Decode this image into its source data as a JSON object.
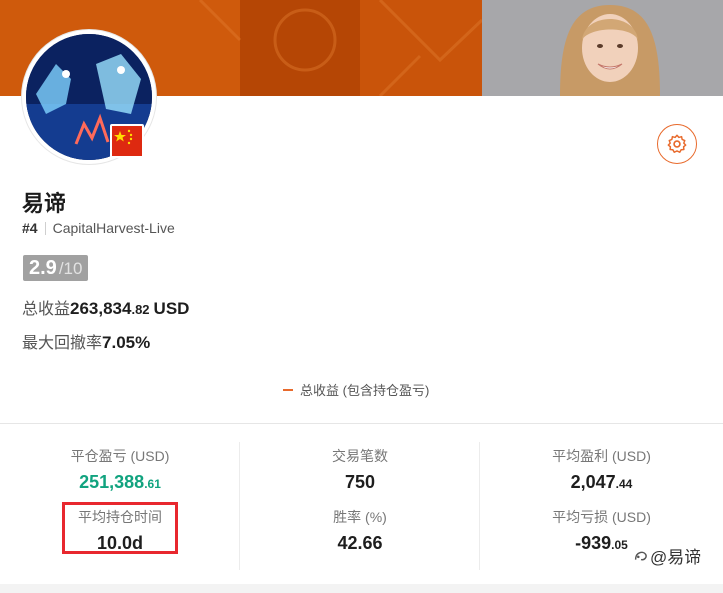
{
  "profile": {
    "name": "易谛",
    "rank": "#4",
    "account": "CapitalHarvest-Live",
    "score": "2.9",
    "score_max": "/10"
  },
  "summary": {
    "total_profit_label": "总收益",
    "total_profit_int": "263,834",
    "total_profit_dec": ".82",
    "total_profit_unit": "USD",
    "max_drawdown_label": "最大回撤率",
    "max_drawdown_value": "7.05%"
  },
  "chart_legend": "总收益 (包含持仓盈亏)",
  "stats": {
    "closed_pl_label": "平仓盈亏 (USD)",
    "closed_pl_int": "251,388",
    "closed_pl_dec": ".61",
    "trades_label": "交易笔数",
    "trades_value": "750",
    "avg_profit_label": "平均盈利 (USD)",
    "avg_profit_int": "2,047",
    "avg_profit_dec": ".44",
    "avg_hold_label": "平均持仓时间",
    "avg_hold_value": "10.0d",
    "win_rate_label": "胜率 (%)",
    "win_rate_value": "42.66",
    "avg_loss_label": "平均亏损 (USD)",
    "avg_loss_int": "-939",
    "avg_loss_dec": ".05"
  },
  "watermark": "@易谛",
  "colors": {
    "accent": "#e86a2c",
    "positive": "#11a37f",
    "highlight_box": "#e8272e"
  },
  "icons": [
    "settings-gear-icon",
    "china-flag-icon",
    "watermark-logo-icon"
  ]
}
